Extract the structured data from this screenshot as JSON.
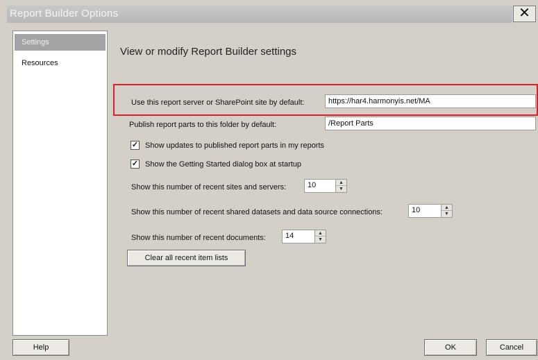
{
  "window": {
    "title": "Report Builder Options",
    "close_glyph": "✕"
  },
  "nav": {
    "items": [
      {
        "label": "Settings",
        "selected": true
      },
      {
        "label": "Resources",
        "selected": false
      }
    ]
  },
  "settings": {
    "heading": "View or modify Report Builder settings",
    "server_label": "Use this report server or SharePoint site by default:",
    "server_value": "https://har4.harmonyis.net/MA",
    "folder_label": "Publish report parts to this folder by default:",
    "folder_value": "/Report Parts",
    "check_updates_label": "Show updates to published report parts in my reports",
    "check_updates_checked": true,
    "check_getting_started_label": "Show the Getting Started dialog box at startup",
    "check_getting_started_checked": true,
    "check_glyph": "✓",
    "recent_sites_label": "Show this number of recent sites and servers:",
    "recent_sites_value": "10",
    "recent_datasets_label": "Show this number of recent shared datasets and data source connections:",
    "recent_datasets_value": "10",
    "recent_docs_label": "Show this number of recent documents:",
    "recent_docs_value": "14",
    "clear_button": "Clear all recent item lists"
  },
  "footer": {
    "help": "Help",
    "ok": "OK",
    "cancel": "Cancel"
  },
  "colors": {
    "highlight_border": "#e21f26",
    "nav_selected_bg": "#a3a3a3"
  }
}
